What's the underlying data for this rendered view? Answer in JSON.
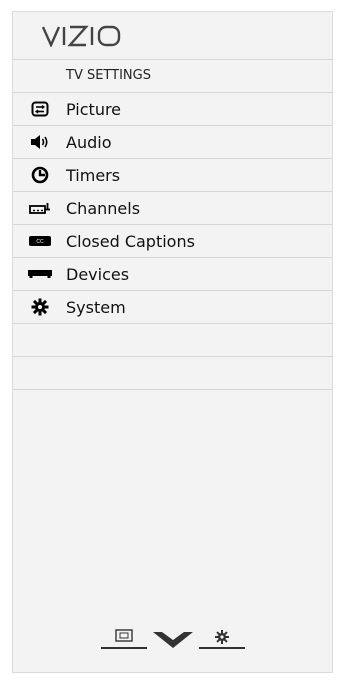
{
  "brand": {
    "logo_text": "VIZIO"
  },
  "menu": {
    "title": "TV SETTINGS",
    "items": [
      {
        "label": "Picture",
        "icon": "picture-icon"
      },
      {
        "label": "Audio",
        "icon": "speaker-icon"
      },
      {
        "label": "Timers",
        "icon": "clock-icon"
      },
      {
        "label": "Channels",
        "icon": "antenna-icon"
      },
      {
        "label": "Closed Captions",
        "icon": "cc-icon"
      },
      {
        "label": "Devices",
        "icon": "device-icon"
      },
      {
        "label": "System",
        "icon": "gear-icon"
      }
    ]
  },
  "bottom_nav": {
    "items": [
      {
        "icon": "screen-icon"
      },
      {
        "icon": "vizio-v-icon"
      },
      {
        "icon": "settings-gear-icon"
      }
    ]
  }
}
